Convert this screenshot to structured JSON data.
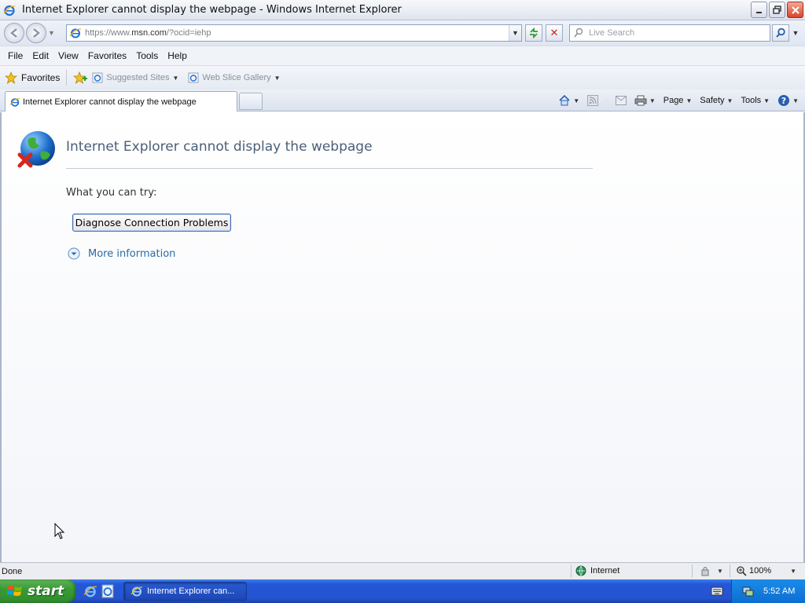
{
  "window": {
    "title": "Internet Explorer cannot display the webpage - Windows Internet Explorer"
  },
  "address": {
    "url_prefix": "https://www.",
    "url_domain": "msn.com",
    "url_suffix": "/?ocid=iehp"
  },
  "search": {
    "placeholder": "Live Search"
  },
  "menu": {
    "items": [
      "File",
      "Edit",
      "View",
      "Favorites",
      "Tools",
      "Help"
    ]
  },
  "favorites_bar": {
    "favorites_label": "Favorites",
    "links": [
      "Suggested Sites",
      "Web Slice Gallery"
    ]
  },
  "tab": {
    "label": "Internet Explorer cannot display the webpage"
  },
  "command_bar": {
    "page_label": "Page",
    "safety_label": "Safety",
    "tools_label": "Tools"
  },
  "content": {
    "title": "Internet Explorer cannot display the webpage",
    "try_text": "What you can try:",
    "diagnose_button": "Diagnose Connection Problems",
    "more_info": "More information"
  },
  "status": {
    "text": "Done",
    "zone": "Internet",
    "zoom": "100%"
  },
  "taskbar": {
    "start_label": "start",
    "task_label": "Internet Explorer can...",
    "time": "5:52 AM"
  },
  "colors": {
    "title_text": "#4a5f78",
    "link": "#2d6ba3",
    "taskbar_blue": "#2554d0",
    "start_green": "#3a9b36"
  }
}
